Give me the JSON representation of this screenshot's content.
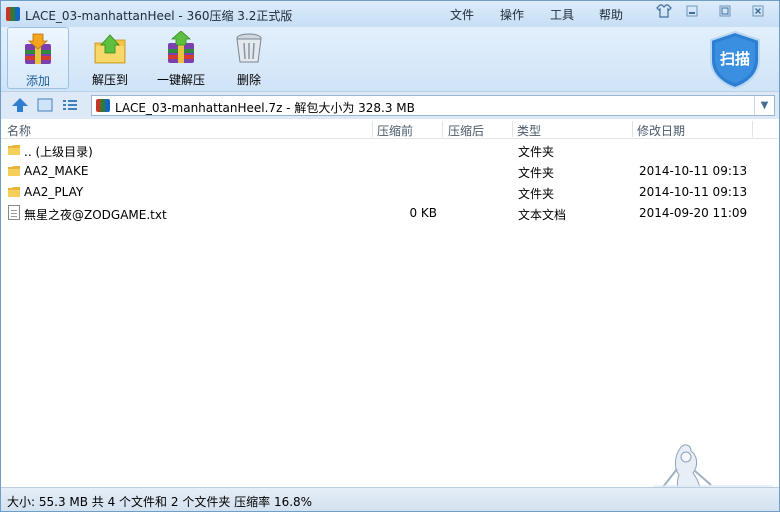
{
  "window": {
    "title": "LACE_03-manhattanHeel - 360压缩 3.2正式版",
    "menus": [
      "文件",
      "操作",
      "工具",
      "帮助"
    ],
    "icons": [
      "app-icon",
      "skin-icon",
      "minimize-icon",
      "restore-icon",
      "close-icon"
    ]
  },
  "toolbar": {
    "buttons": [
      {
        "label": "添加",
        "icon": "add-archive-icon",
        "active": true
      },
      {
        "label": "解压到",
        "icon": "extract-to-icon",
        "active": false
      },
      {
        "label": "一键解压",
        "icon": "one-click-extract-icon",
        "active": false
      },
      {
        "label": "删除",
        "icon": "delete-bin-icon",
        "active": false
      }
    ],
    "scan_label": "扫描"
  },
  "address": {
    "path": "LACE_03-manhattanHeel.7z - 解包大小为 328.3 MB"
  },
  "list": {
    "columns": [
      "名称",
      "压缩前",
      "压缩后",
      "类型",
      "修改日期"
    ],
    "rows": [
      {
        "name": ".. (上级目录)",
        "before": "",
        "after": "",
        "type": "文件夹",
        "date": "",
        "icon": "folder-icon"
      },
      {
        "name": "AA2_MAKE",
        "before": "",
        "after": "",
        "type": "文件夹",
        "date": "2014-10-11 09:13",
        "icon": "folder-icon"
      },
      {
        "name": "AA2_PLAY",
        "before": "",
        "after": "",
        "type": "文件夹",
        "date": "2014-10-11 09:13",
        "icon": "folder-icon"
      },
      {
        "name": "無星之夜@ZODGAME.txt",
        "before": "0 KB",
        "after": "",
        "type": "文本文档",
        "date": "2014-09-20 11:09",
        "icon": "text-file-icon"
      }
    ]
  },
  "status": {
    "text": "大小: 55.3 MB 共 4 个文件和 2 个文件夹 压缩率 16.8%"
  },
  "colors": {
    "title_bg": "#dcecfb",
    "toolbar_bg": "#d8e8f8",
    "accent": "#1f6fc5",
    "shield": "#2d7fd3"
  }
}
